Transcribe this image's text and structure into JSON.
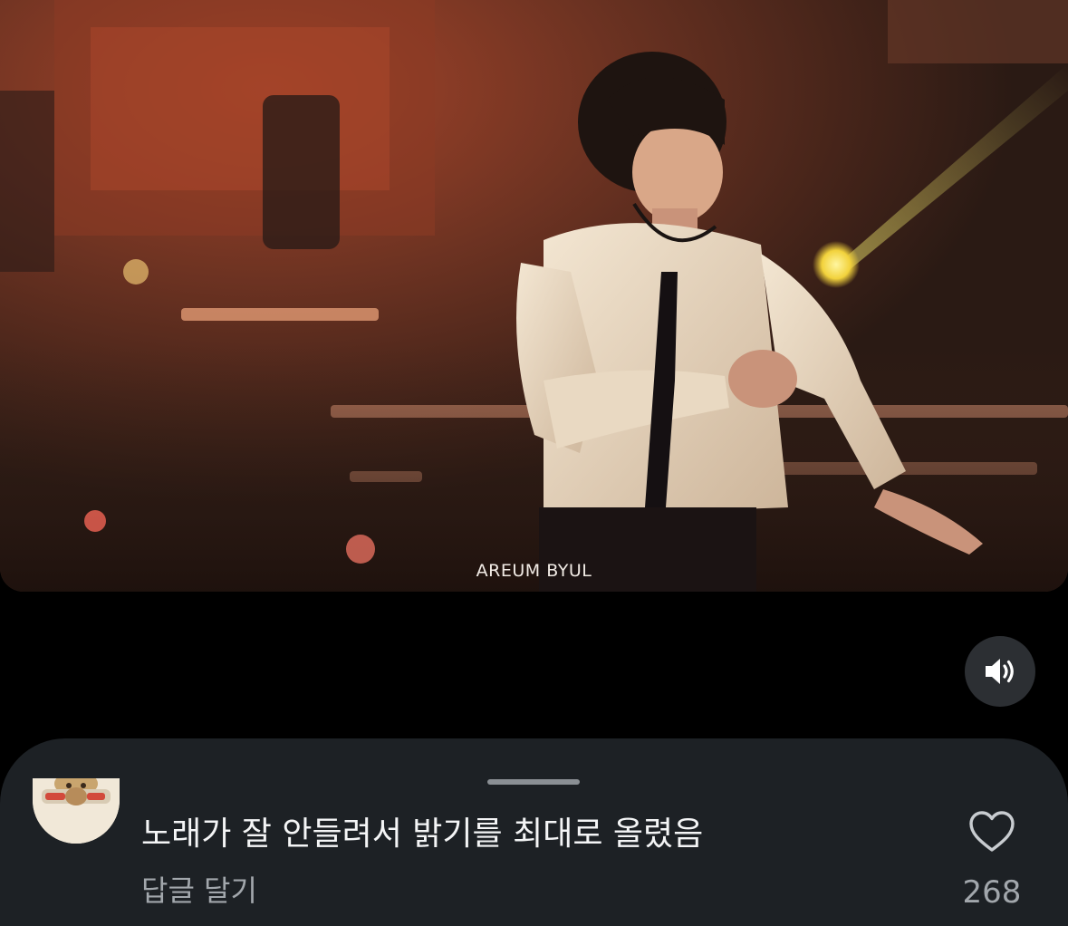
{
  "video": {
    "watermark": "AREUM BYUL"
  },
  "controls": {
    "sound_icon": "speaker-sound-on-icon"
  },
  "comment_sheet": {
    "comment": {
      "text": "노래가 잘 안들려서 밝기를 최대로 올렸음",
      "reply_label": "답글 달기",
      "like_icon": "heart-outline-icon",
      "like_count": "268"
    }
  },
  "colors": {
    "background": "#000000",
    "sheet_background": "#1d2125",
    "primary_text": "#f4f5f6",
    "secondary_text": "#a2a7ac",
    "sound_button_background": "#2c2f33"
  }
}
